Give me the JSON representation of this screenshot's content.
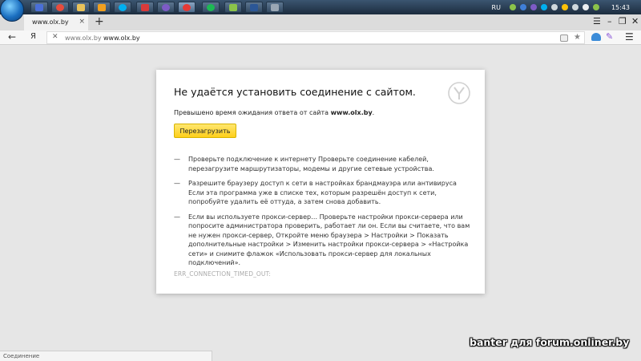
{
  "colors": {
    "accent_button": "#ffd93a",
    "page_background": "#e6e6e6"
  },
  "taskbar": {
    "apps": [
      "file-manager-icon",
      "chrome-icon",
      "folder-icon",
      "media-player-icon",
      "skype-icon",
      "browser-icon",
      "viber-icon",
      "yandex-browser-icon",
      "spotify-icon",
      "android-icon",
      "word-icon",
      "image-viewer-icon"
    ],
    "tray": {
      "language": "RU",
      "clock": "15:43"
    }
  },
  "browser": {
    "tab_title": "www.olx.by",
    "tab_close": "×",
    "new_tab": "+",
    "yandex_letter": "Я",
    "url_host": "www.olx.by",
    "url_full": "www.olx.by"
  },
  "error": {
    "title": "Не удаётся установить соединение с сайтом.",
    "desc_prefix": "Превышено время ожидания ответа от сайта ",
    "desc_site": "www.olx.by",
    "desc_suffix": ".",
    "reload_label": "Перезагрузить",
    "tips": [
      "Проверьте подключение к интернету Проверьте соединение кабелей, перезагрузите маршрутизаторы, модемы и другие сетевые устройства.",
      "Разрешите браузеру доступ к сети в настройках брандмауэра или антивируса Если эта программа уже в списке тех, которым разрешён доступ к сети, попробуйте удалить её оттуда, а затем снова добавить.",
      "Если вы используете прокси-сервер… Проверьте настройки прокси-сервера или попросите администратора проверить, работает ли он. Если вы считаете, что вам не нужен прокси-сервер, Откройте меню браузера > Настройки > Показать дополнительные настройки > Изменить настройки прокси-сервера > «Настройка сети» и снимите флажок «Использовать прокси-сервер для локальных подключений»."
    ],
    "dash": "—",
    "code": "ERR_CONNECTION_TIMED_OUT:"
  },
  "status_text": "Соединение",
  "watermark": "banter для forum.onliner.by"
}
